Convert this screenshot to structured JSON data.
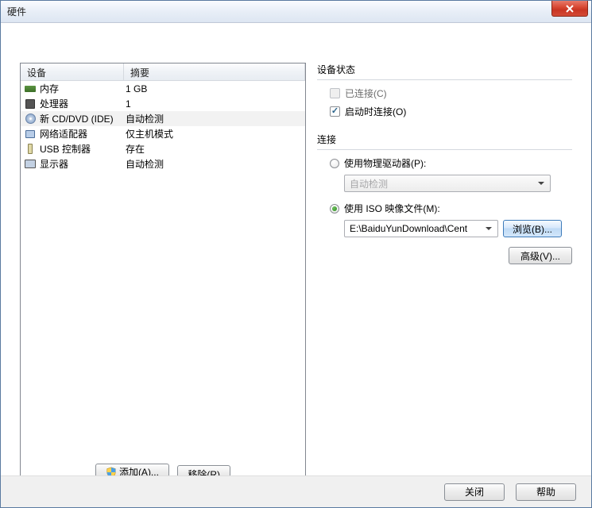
{
  "window": {
    "title": "硬件"
  },
  "left": {
    "headers": {
      "device": "设备",
      "summary": "摘要"
    },
    "rows": [
      {
        "name": "内存",
        "summary": "1 GB",
        "icon": "memory"
      },
      {
        "name": "处理器",
        "summary": "1",
        "icon": "cpu"
      },
      {
        "name": "新 CD/DVD (IDE)",
        "summary": "自动检测",
        "icon": "cd",
        "selected": true
      },
      {
        "name": "网络适配器",
        "summary": "仅主机模式",
        "icon": "network"
      },
      {
        "name": "USB 控制器",
        "summary": "存在",
        "icon": "usb"
      },
      {
        "name": "显示器",
        "summary": "自动检测",
        "icon": "display"
      }
    ],
    "buttons": {
      "add": "添加(A)...",
      "remove": "移除(R)"
    }
  },
  "right": {
    "status": {
      "title": "设备状态",
      "connected": "已连接(C)",
      "connect_on_start": "启动时连接(O)"
    },
    "connection": {
      "title": "连接",
      "use_physical": "使用物理驱动器(P):",
      "physical_value": "自动检测",
      "use_iso": "使用 ISO 映像文件(M):",
      "iso_path": "E:\\BaiduYunDownload\\Cent",
      "browse": "浏览(B)..."
    },
    "advanced": "高级(V)..."
  },
  "footer": {
    "close": "关闭",
    "help": "帮助"
  }
}
